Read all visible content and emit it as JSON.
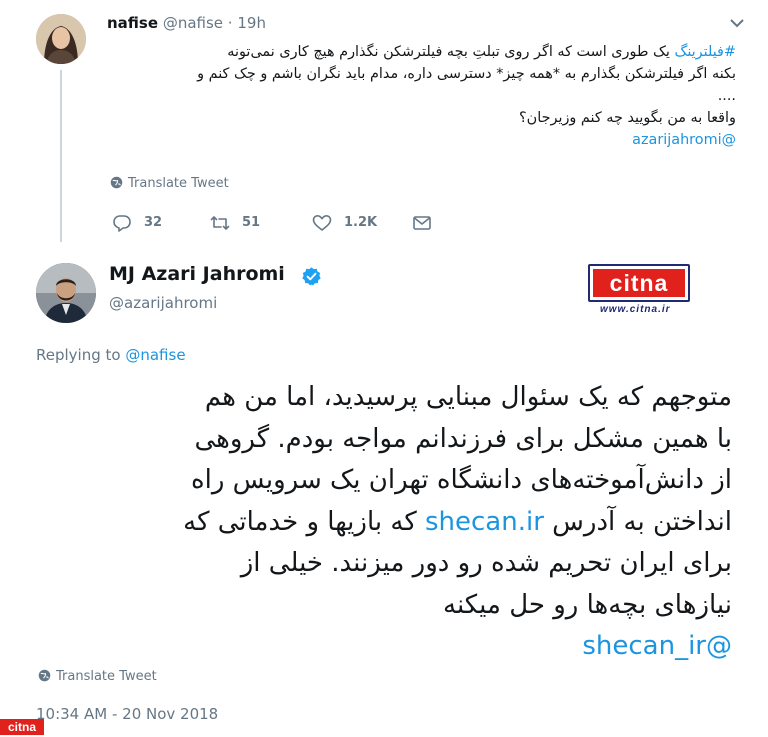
{
  "parent_tweet": {
    "display_name": "nafise",
    "handle": "@nafise",
    "time": "19h",
    "text_lines": [
      {
        "hashtag": "#فیلترینگ",
        "rest": " یک طوری است که اگر روی تبلتِ بچه فیلترشکن نگذارم هیچ کاری نمی‌تونه"
      },
      {
        "text": "بکنه اگر فیلترشکن بگذارم به *همه چیز* دسترسی داره، مدام باید نگران باشم و چک کنم و"
      },
      {
        "text": "...."
      },
      {
        "text": "واقعا به من بگویید چه کنم وزیرجان؟"
      }
    ],
    "mention": "@azarijahromi",
    "translate_label": "Translate Tweet",
    "actions": {
      "replies": "32",
      "retweets": "51",
      "likes": "1.2K"
    }
  },
  "main_tweet": {
    "display_name": "MJ Azari Jahromi",
    "handle": "@azarijahromi",
    "replying_prefix": "Replying to",
    "replying_to": "@nafise",
    "lines": [
      {
        "text": "متوجهم که یک سئوال مبنایی پرسیدید، اما من هم"
      },
      {
        "text": "با همین مشکل برای فرزندانم مواجه بودم. گروهی"
      },
      {
        "text": "از دانش‌آموخته‌های دانشگاه تهران یک سرویس راه"
      },
      {
        "before": "انداختن به آدرس ",
        "link": "shecan.ir",
        "after": " که بازیها و خدماتی که"
      },
      {
        "text": "برای ایران تحریم شده رو دور میزنند. خیلی از"
      },
      {
        "text": "نیازهای بچه‌ها رو حل میکنه"
      }
    ],
    "mention": "@shecan_ir",
    "translate_label": "Translate Tweet",
    "timestamp": "10:34 AM - 20 Nov 2018"
  },
  "logo": {
    "brand": "citna",
    "url": "www.citna.ir",
    "watermark": "citna"
  },
  "colors": {
    "link": "#1b95e0",
    "muted": "#657786",
    "text": "#14171a",
    "brand_red": "#e0211c",
    "verified": "#1da1f2"
  }
}
